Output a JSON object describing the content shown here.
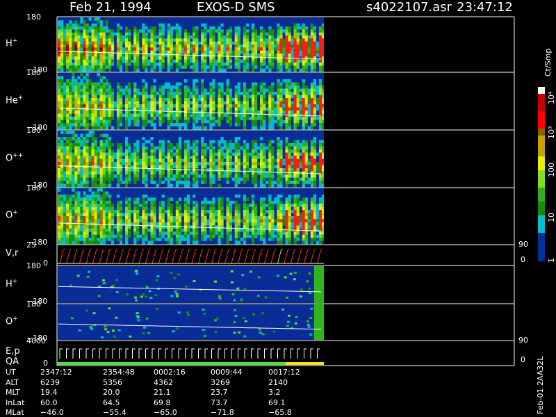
{
  "header": {
    "date": "Feb 21, 1994",
    "instrument": "EXOS-D SMS",
    "file": "s4022107.asr",
    "time": "23:47:12"
  },
  "chart_data": {
    "type": "heatmap",
    "panels": [
      {
        "label_base": "H",
        "label_sup": "+",
        "ymax": "180",
        "ymin": "−180",
        "kind": "spectrogram",
        "fill": 0.48,
        "intensity": 1.0
      },
      {
        "label_base": "He",
        "label_sup": "+",
        "ymax": "180",
        "ymin": "−180",
        "kind": "spectrogram",
        "fill": 0.48,
        "intensity": 0.8
      },
      {
        "label_base": "O",
        "label_sup": "++",
        "ymax": "180",
        "ymin": "−180",
        "kind": "spectrogram",
        "fill": 0.48,
        "intensity": 0.8
      },
      {
        "label_base": "O",
        "label_sup": "+",
        "ymax": "180",
        "ymin": "−180",
        "kind": "spectrogram",
        "fill": 0.48,
        "intensity": 0.85
      },
      {
        "label_base": "V,r",
        "label_sup": "",
        "ymax": "25",
        "ymin": "0",
        "right_max": "90",
        "right_min": "0",
        "kind": "line"
      },
      {
        "label_base": "H",
        "label_sup": "+",
        "ymax": "180",
        "ymin": "−180",
        "kind": "sparse"
      },
      {
        "label_base": "O",
        "label_sup": "+",
        "ymax": "180",
        "ymin": "−180",
        "kind": "sparse"
      },
      {
        "label_base": "E,p",
        "label_sub": "QA",
        "ymax": "4000",
        "ymin": "0",
        "right_max": "90",
        "right_min": "0",
        "kind": "step"
      }
    ],
    "colorbar": {
      "unit": "Ct/Smp",
      "labels": [
        "10⁴",
        "10³",
        "100",
        "10",
        "1"
      ]
    },
    "time_table": {
      "rows": [
        {
          "name": "UT",
          "values": [
            "2347:12",
            "2354:48",
            "0002:16",
            "0009:44",
            "0017:12"
          ]
        },
        {
          "name": "ALT",
          "values": [
            "6239",
            "5356",
            "4362",
            "3269",
            "2140"
          ]
        },
        {
          "name": "MLT",
          "values": [
            "19.4",
            "20.0",
            "21.1",
            "23.7",
            "3.2"
          ]
        },
        {
          "name": "InLat",
          "values": [
            "60.0",
            "64.5",
            "69.8",
            "73.7",
            "69.1"
          ]
        },
        {
          "name": "MLat",
          "values": [
            "−46.0",
            "−55.4",
            "−65.0",
            "−71.8",
            "−65.8"
          ]
        }
      ]
    }
  },
  "footer": {
    "stamp": "Feb-01 2AA32L"
  }
}
